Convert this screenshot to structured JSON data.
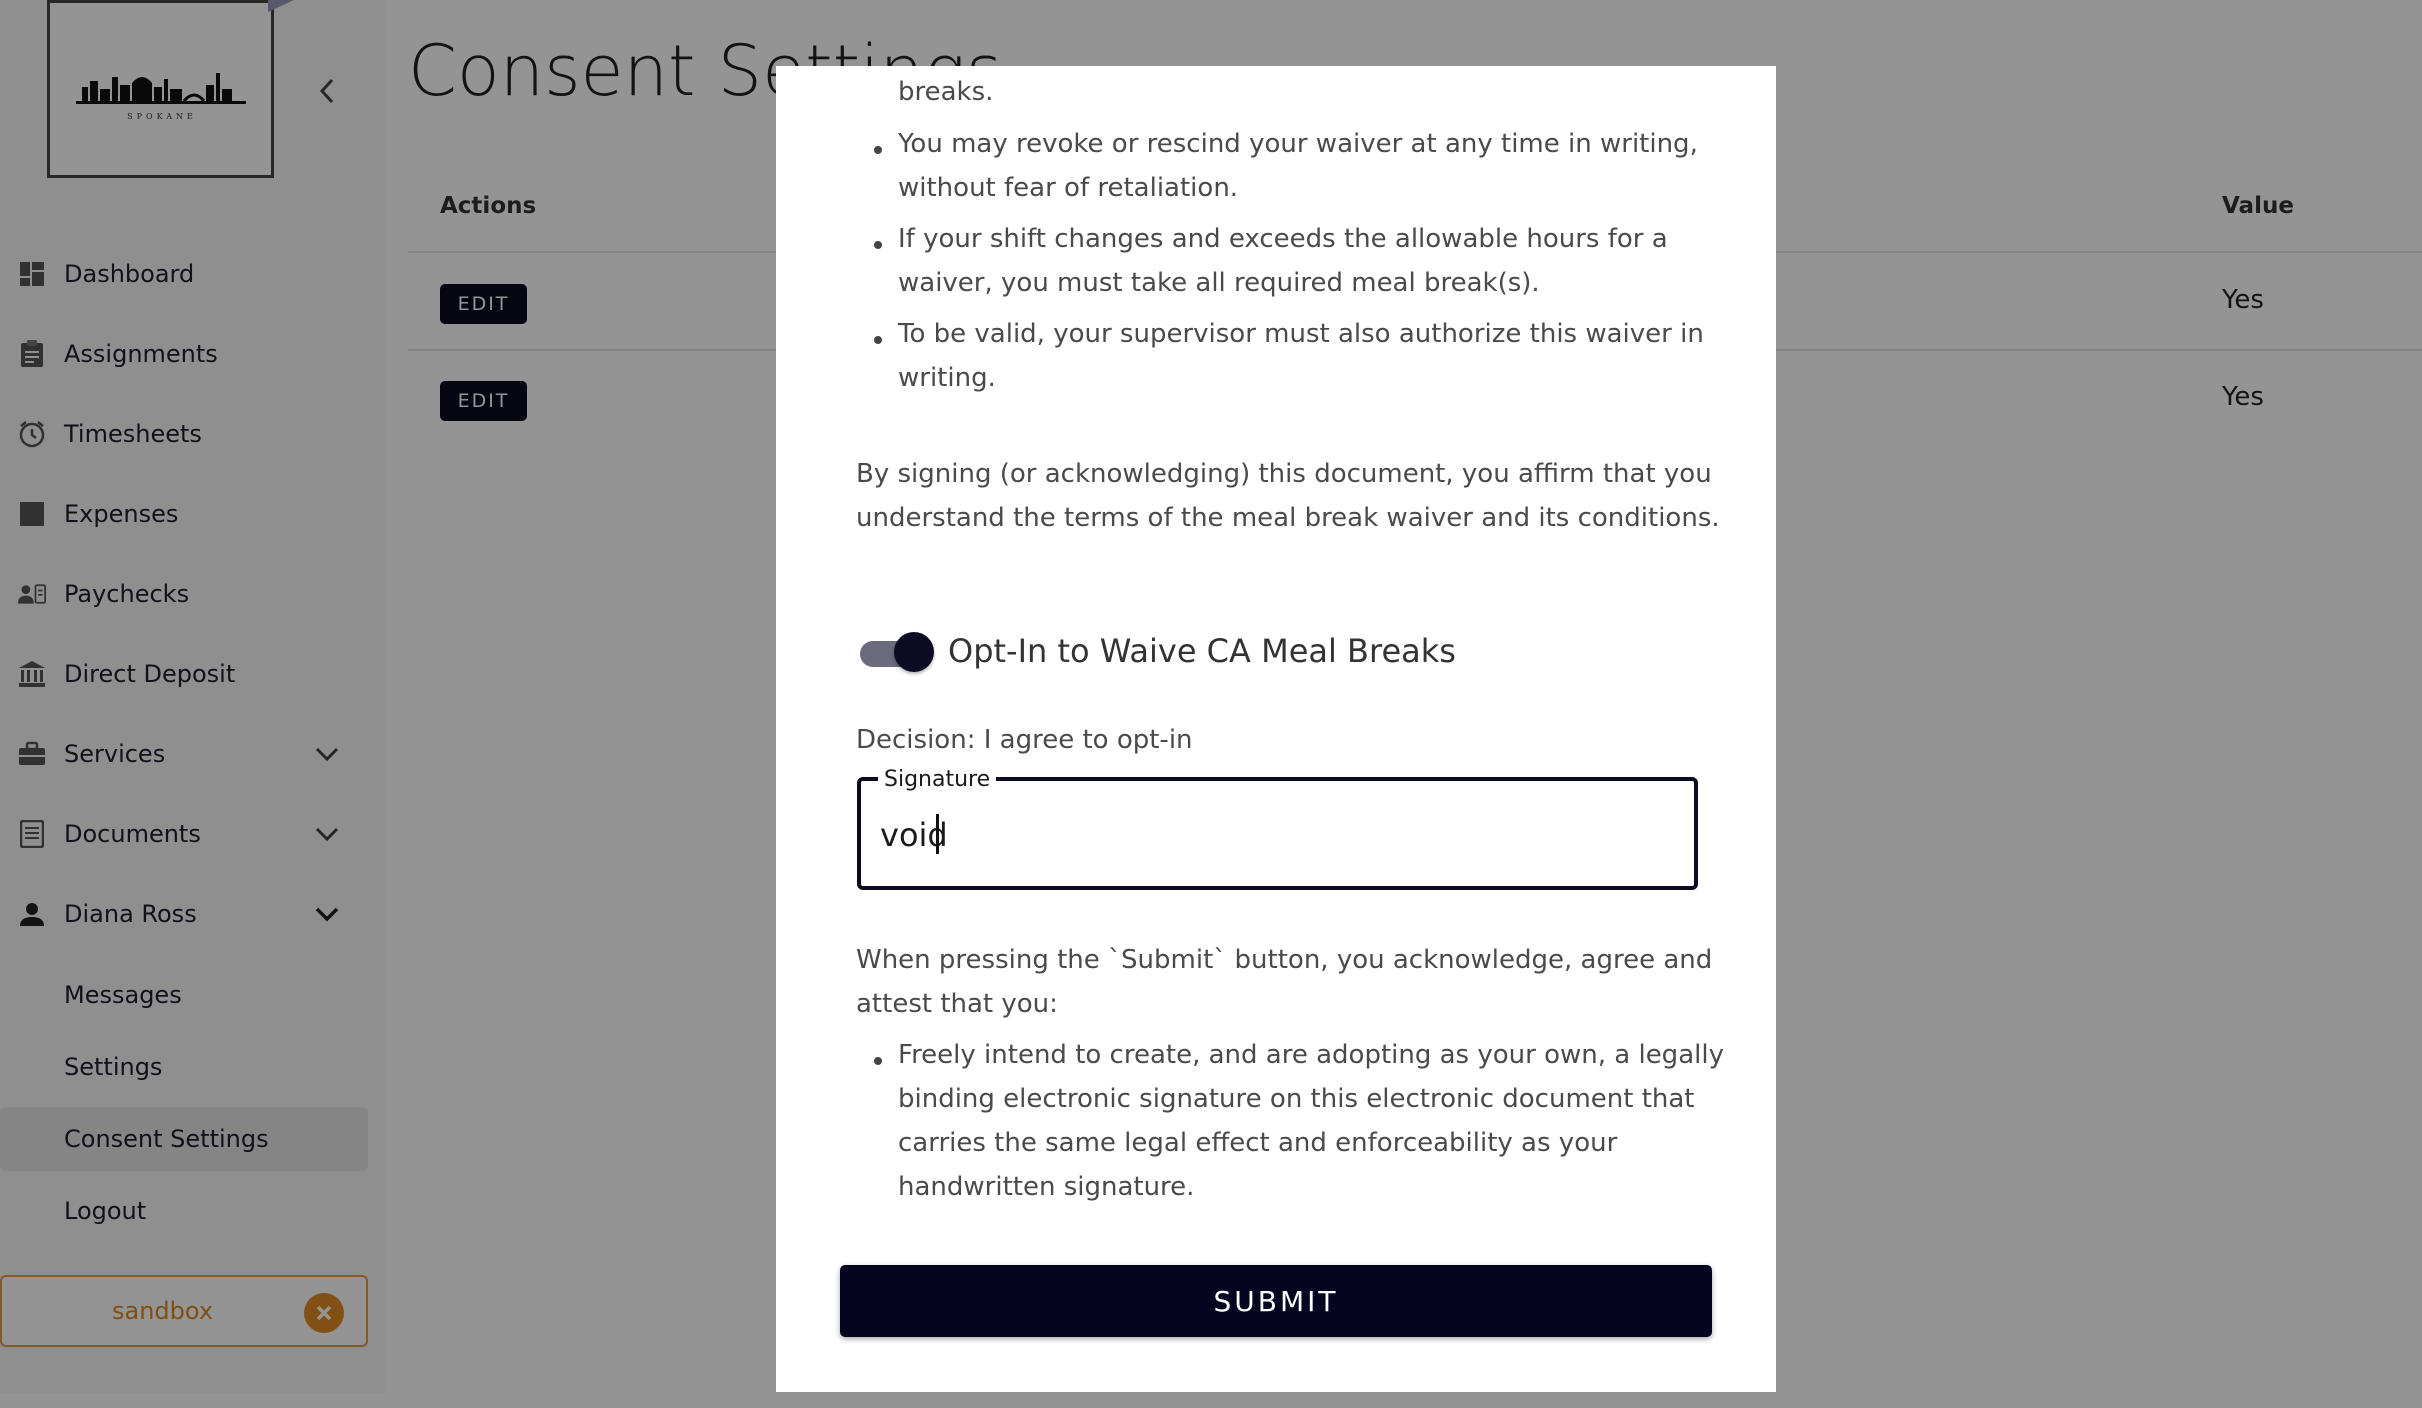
{
  "sidebar": {
    "logo_text": "SPOKANE",
    "items": [
      {
        "label": "Dashboard",
        "icon": "dashboard-icon"
      },
      {
        "label": "Assignments",
        "icon": "clipboard-icon"
      },
      {
        "label": "Timesheets",
        "icon": "clock-icon"
      },
      {
        "label": "Expenses",
        "icon": "square-icon"
      },
      {
        "label": "Paychecks",
        "icon": "paycheck-icon"
      },
      {
        "label": "Direct Deposit",
        "icon": "bank-icon"
      },
      {
        "label": "Services",
        "icon": "briefcase-icon"
      },
      {
        "label": "Documents",
        "icon": "document-icon"
      },
      {
        "label": "Diana Ross",
        "icon": "person-icon"
      }
    ],
    "sub_items": [
      {
        "label": "Messages"
      },
      {
        "label": "Settings"
      },
      {
        "label": "Consent Settings",
        "active": true
      },
      {
        "label": "Logout"
      }
    ],
    "sandbox_label": "sandbox"
  },
  "main": {
    "title": "Consent Settings",
    "table": {
      "headers": {
        "actions": "Actions",
        "value": "Value"
      },
      "rows": [
        {
          "action": "EDIT",
          "value": "Yes"
        },
        {
          "action": "EDIT",
          "value": "Yes"
        }
      ]
    }
  },
  "modal": {
    "top_fragment": "breaks.",
    "bullets_top": [
      {
        "line1": "You may revoke or rescind your waiver at any time in writing,",
        "line2": "without fear of retaliation."
      },
      {
        "line1": "If your shift changes and exceeds the allowable hours for a",
        "line2": "waiver, you must take all required meal break(s)."
      },
      {
        "line1": "To be valid, your supervisor must also authorize this waiver in",
        "line2": "writing."
      }
    ],
    "affirm_line1": "By signing (or acknowledging) this document, you affirm that you",
    "affirm_line2": "understand the terms of the meal break waiver and its conditions.",
    "toggle_label": "Opt-In to Waive CA Meal Breaks",
    "toggle_on": true,
    "decision": "Decision: I agree to opt-in",
    "signature_label": "Signature",
    "signature_value": "void",
    "attest_line1": "When pressing the `Submit` button, you acknowledge, agree and",
    "attest_line2": "attest that you:",
    "attest_bullet": {
      "line1": "Freely intend to create, and are adopting as your own, a legally",
      "line2": "binding electronic signature on this electronic document that",
      "line3": "carries the same legal effect and enforceability as your",
      "line4": "handwritten signature."
    },
    "submit_label": "SUBMIT"
  },
  "colors": {
    "primary": "#050520",
    "sandbox_accent": "#e08a25",
    "overlay": "rgba(0,0,0,0.42)"
  }
}
